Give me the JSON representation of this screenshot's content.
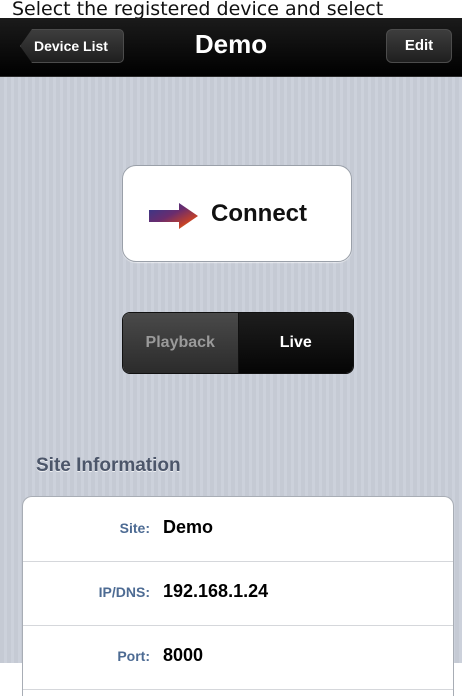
{
  "caption": "Select the registered device and select",
  "navbar": {
    "back_label": "Device List",
    "title": "Demo",
    "edit_label": "Edit"
  },
  "connect": {
    "label": "Connect",
    "icon": "arrow-right-icon"
  },
  "segment": {
    "options": [
      "Playback",
      "Live"
    ],
    "selected": "Live"
  },
  "site_info": {
    "header": "Site Information",
    "rows": [
      {
        "label": "Site:",
        "value": "Demo"
      },
      {
        "label": "IP/DNS:",
        "value": "192.168.1.24"
      },
      {
        "label": "Port:",
        "value": "8000"
      }
    ]
  }
}
